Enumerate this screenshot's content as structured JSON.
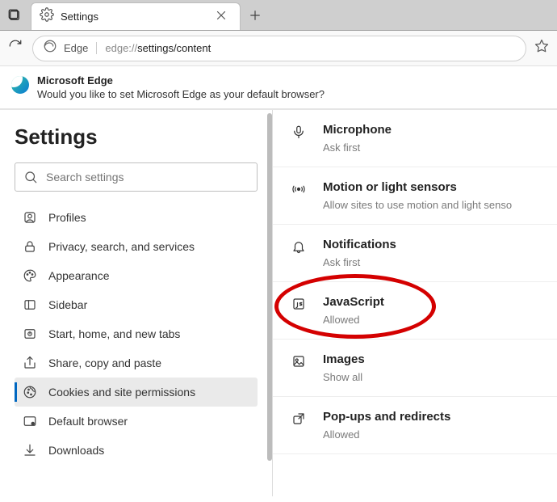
{
  "tab": {
    "title": "Settings"
  },
  "address": {
    "scheme_label": "Edge",
    "url_prefix": "edge://",
    "url_path": "settings/content"
  },
  "infobar": {
    "title": "Microsoft Edge",
    "subtitle": "Would you like to set Microsoft Edge as your default browser?"
  },
  "sidebar": {
    "heading": "Settings",
    "search_placeholder": "Search settings",
    "items": [
      {
        "label": "Profiles"
      },
      {
        "label": "Privacy, search, and services"
      },
      {
        "label": "Appearance"
      },
      {
        "label": "Sidebar"
      },
      {
        "label": "Start, home, and new tabs"
      },
      {
        "label": "Share, copy and paste"
      },
      {
        "label": "Cookies and site permissions"
      },
      {
        "label": "Default browser"
      },
      {
        "label": "Downloads"
      }
    ]
  },
  "permissions": [
    {
      "title": "Microphone",
      "desc": "Ask first"
    },
    {
      "title": "Motion or light sensors",
      "desc": "Allow sites to use motion and light senso"
    },
    {
      "title": "Notifications",
      "desc": "Ask first"
    },
    {
      "title": "JavaScript",
      "desc": "Allowed"
    },
    {
      "title": "Images",
      "desc": "Show all"
    },
    {
      "title": "Pop-ups and redirects",
      "desc": "Allowed"
    }
  ]
}
